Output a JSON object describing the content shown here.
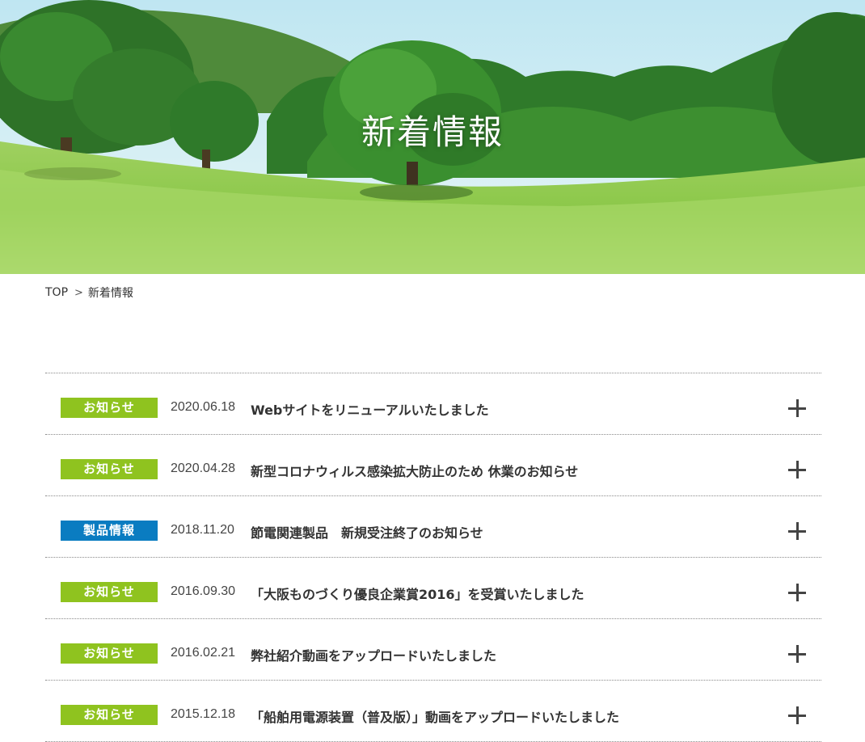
{
  "hero": {
    "title": "新着情報"
  },
  "breadcrumb": {
    "home": "TOP",
    "separator": ">",
    "current": "新着情報"
  },
  "colors": {
    "notice_badge": "#8fc31f",
    "product_badge": "#0a7cc1"
  },
  "news": [
    {
      "category": "お知らせ",
      "category_type": "notice",
      "date": "2020.06.18",
      "title": "Webサイトをリニューアルいたしました"
    },
    {
      "category": "お知らせ",
      "category_type": "notice",
      "date": "2020.04.28",
      "title": "新型コロナウィルス感染拡大防止のため 休業のお知らせ"
    },
    {
      "category": "製品情報",
      "category_type": "product",
      "date": "2018.11.20",
      "title": "節電関連製品　新規受注終了のお知らせ"
    },
    {
      "category": "お知らせ",
      "category_type": "notice",
      "date": "2016.09.30",
      "title": "「大阪ものづくり優良企業賞2016」を受賞いたしました"
    },
    {
      "category": "お知らせ",
      "category_type": "notice",
      "date": "2016.02.21",
      "title": "弊社紹介動画をアップロードいたしました"
    },
    {
      "category": "お知らせ",
      "category_type": "notice",
      "date": "2015.12.18",
      "title": "「船舶用電源装置（普及版）」動画をアップロードいたしました"
    }
  ],
  "icons": {
    "expand": "plus-icon"
  }
}
